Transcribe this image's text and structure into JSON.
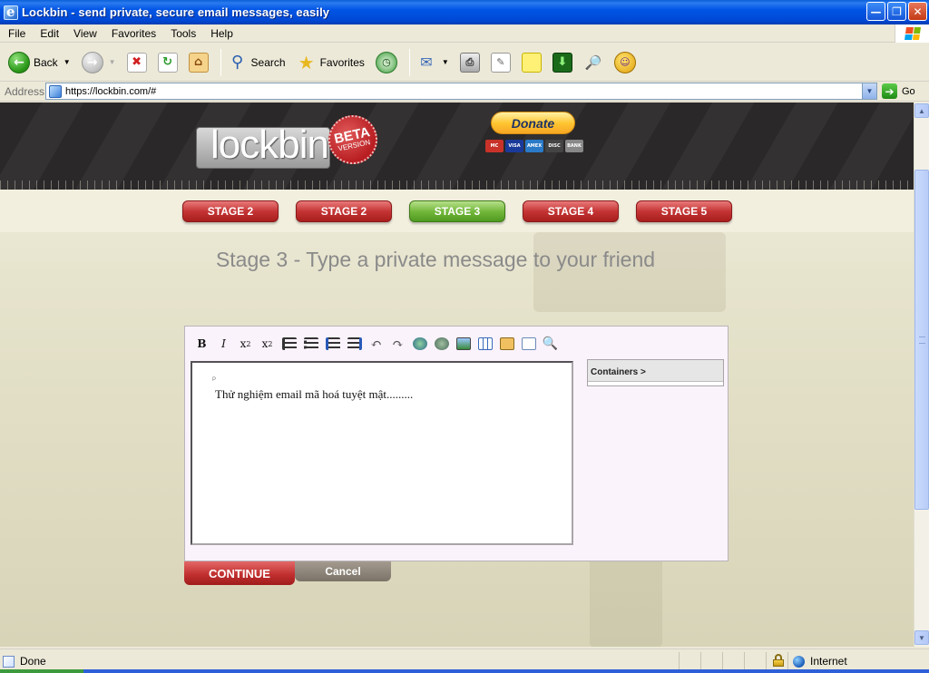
{
  "window": {
    "title": "Lockbin - send private, secure email messages, easily",
    "controls": [
      "minimize",
      "maximize",
      "close"
    ]
  },
  "menu": {
    "items": [
      "File",
      "Edit",
      "View",
      "Favorites",
      "Tools",
      "Help"
    ]
  },
  "toolbar": {
    "back_label": "Back",
    "search_label": "Search",
    "favorites_label": "Favorites"
  },
  "address": {
    "label": "Address",
    "url": "https://lockbin.com/#",
    "go_label": "Go"
  },
  "site": {
    "logo_text": "lockbin",
    "beta": "BETA",
    "beta_version": "VERSION",
    "donate_label": "Donate",
    "cards": [
      "MC",
      "VISA",
      "AMEX",
      "DISC",
      "BANK"
    ],
    "stages": [
      {
        "label": "STAGE 2",
        "active": false
      },
      {
        "label": "STAGE 2",
        "active": false
      },
      {
        "label": "STAGE 3",
        "active": true
      },
      {
        "label": "STAGE 4",
        "active": false
      },
      {
        "label": "STAGE 5",
        "active": false
      }
    ],
    "heading": "Stage 3 - Type a private message to your friend"
  },
  "editor": {
    "buttons": [
      "bold",
      "italic",
      "superscript",
      "subscript",
      "ordered-list",
      "unordered-list",
      "outdent",
      "indent",
      "undo",
      "redo",
      "link",
      "unlink",
      "image",
      "table",
      "paste",
      "source",
      "preview"
    ],
    "p_tag": "P",
    "message": "Thử nghiệm email mã hoá tuyệt mật.........",
    "containers_label": "Containers >"
  },
  "actions": {
    "continue_label": "CONTINUE",
    "cancel_label": "Cancel"
  },
  "status": {
    "text": "Done",
    "zone": "Internet"
  }
}
